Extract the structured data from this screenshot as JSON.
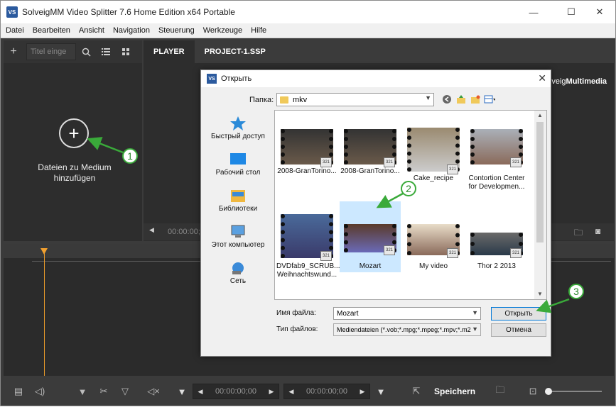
{
  "window": {
    "title": "SolveigMM Video Splitter 7.6 Home Edition x64 Portable",
    "icon_text": "VS",
    "controls": {
      "minimize": "—",
      "maximize": "☐",
      "close": "✕"
    }
  },
  "menu": [
    "Datei",
    "Bearbeiten",
    "Ansicht",
    "Navigation",
    "Steuerung",
    "Werkzeuge",
    "Hilfe"
  ],
  "left_panel": {
    "search_placeholder": "Titel einge",
    "add_media_text": "Dateien zu Medium hinzufügen"
  },
  "tabs": [
    "PLAYER",
    "PROJECT-1.SSP"
  ],
  "brand": {
    "prefix": "olveig",
    "bold": "Multimedia"
  },
  "player_time": "00:00:00;",
  "bottom": {
    "time1": "00:00:00;00",
    "time2": "00:00:00;00",
    "save_label": "Speichern"
  },
  "dialog": {
    "title": "Открыть",
    "icon_text": "VS",
    "folder_label": "Папка:",
    "folder_value": "mkv",
    "places": [
      {
        "label": "Быстрый доступ",
        "icon": "star-icon"
      },
      {
        "label": "Рабочий стол",
        "icon": "desktop-icon"
      },
      {
        "label": "Библиотеки",
        "icon": "libraries-icon"
      },
      {
        "label": "Этот компьютер",
        "icon": "computer-icon"
      },
      {
        "label": "Сеть",
        "icon": "network-icon"
      }
    ],
    "files": [
      {
        "name": "2008-GranTorino...",
        "selected": false
      },
      {
        "name": "2008-GranTorino...",
        "selected": false
      },
      {
        "name": "Cake_recipe",
        "selected": false
      },
      {
        "name": "Contortion Center for Developmen...",
        "selected": false
      },
      {
        "name": "DVDfab9_SCRUB... Weihnachtswund...",
        "selected": false
      },
      {
        "name": "Mozart",
        "selected": true
      },
      {
        "name": "My video",
        "selected": false
      },
      {
        "name": "Thor 2 2013",
        "selected": false
      }
    ],
    "badge": "321",
    "filename_label": "Имя файла:",
    "filename_value": "Mozart",
    "filetype_label": "Тип файлов:",
    "filetype_value": "Mediendateien (*.vob;*.mpg;*.mpeg;*.mpv;*.m2",
    "open_label": "Открыть",
    "cancel_label": "Отмена"
  },
  "callouts": [
    "1",
    "2",
    "3"
  ],
  "colors": {
    "accent_green": "#3aaa3a",
    "playhead": "#f0a030",
    "selection": "#cce8ff"
  }
}
